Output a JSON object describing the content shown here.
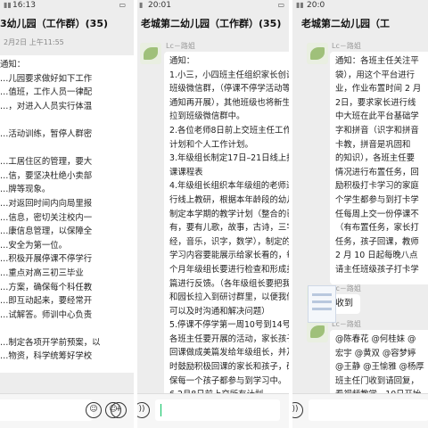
{
  "panel1": {
    "status_time": "16:13",
    "title": "3幼儿园（工作群）(35)",
    "msg_time": "2月2日 上午11:55",
    "lines": [
      "通知：",
      "…儿园要求做好如下工作",
      "…值班，工作人员一律配",
      "…，对进入人员实行体温",
      "",
      "…活动训练，暂停人群密",
      "",
      "…工居住区的管理，要大",
      "…信，要坚决杜绝小卖部",
      "…牌等现象。",
      "…对返回时间内向局里报",
      "…信息，密切关注校内一",
      "…康信息管理，以保障全",
      "…安全为第一位。",
      "…积极开展停课不停学行",
      "…重点对高三初三毕业",
      "…方案，确保每个科任教",
      "…即互动起来，要经常开",
      "…试解答。师训中心负责",
      "",
      "…制定各项开学前预案，以",
      "…物资，科学统筹好学校"
    ]
  },
  "panel2": {
    "status_time": "20:01",
    "title": "老城第二幼儿园（工作群）(35)",
    "sender": "Lc－路姐",
    "lines": [
      "通知：",
      "1.小三，小四班主任组织家长创设",
      "班级微信群，（停课不停学活动等",
      "通知再开展），其他班级也将新生",
      "拉到班级微信群中。",
      "2.各位老师8日前上交班主任工作",
      "计划和个人工作计划。",
      "3.年级组长制定17日–21日线上授",
      "课课程表",
      "4.年级组长组织本年级组的老师进",
      "行线上教研，根据本年龄段的幼儿",
      "制定本学期的教学计划（整合的已",
      "有，要有儿歌，故事，古诗，三字",
      "经，音乐，识字，数学），制定的",
      "学习内容要能展示给家长看的，每",
      "个月年级组长要进行检查和形成美",
      "篇进行反馈。（各年级组长要把我",
      "和园长拉入到研讨群里，以便我们",
      "可以及时沟通和解决问题）",
      "5.停课不停学第一周10号到14号，",
      "各班主任要开展的活动，家长孩子的",
      "回课做成美篇发给年级组长，并及",
      "时鼓励积极回课的家长和孩子，确",
      "保每一个孩子都参与到学习中。",
      "6.2月8日前上交所有计划"
    ]
  },
  "panel3": {
    "status_time": "20:0",
    "title": "老城第二幼儿园（工",
    "sender1": "Lc－路姐",
    "lines1": [
      "通知：各班主任关注平",
      "袋），用这个平台进行",
      "业，作业布置时间 2 月",
      "2日，要求家长进行线",
      "中大班在此平台基础学",
      "字和拼音（识字和拼音",
      "卡教，拼音是巩固和",
      "的知识），各班主任要",
      "情况进行布置任务，回",
      "励积极打卡学习的家庭",
      "个学生都参与到打卡学",
      "任每周上交一份停课不",
      "（有布置任务，家长打",
      "任务，孩子回课，教师",
      "2 月 10 日起每晚八点",
      "请主任班级孩子打卡学"
    ],
    "sender2": "Lc－路姐",
    "reply": "收到",
    "sender3": "Lc－路姐",
    "lines3": [
      "@陈春花 @何桂妹 @",
      "宏宇 @黄双 @容梦婷",
      "@王静 @王愉雅 @杨厚",
      "班主任门收到请回复，",
      "看视频教学，10日开始"
    ]
  },
  "icons": {
    "voice": "voice-icon",
    "emoji": "emoji-icon",
    "plus": "plus-icon"
  }
}
